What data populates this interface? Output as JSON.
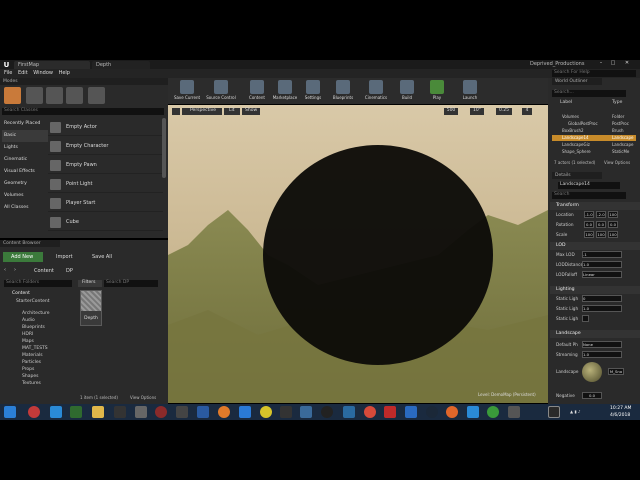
{
  "window": {
    "logo": "U",
    "tabs": [
      "FirstMap",
      "Depth"
    ],
    "project": "Deprived_Productions",
    "search_help_placeholder": "Search For Help"
  },
  "menu": [
    "File",
    "Edit",
    "Window",
    "Help"
  ],
  "modes": {
    "title": "Modes",
    "search_placeholder": "Search Classes",
    "categories": [
      "Recently Placed",
      "Basic",
      "Lights",
      "Cinematic",
      "Visual Effects",
      "Geometry",
      "Volumes",
      "All Classes"
    ],
    "items": [
      "Empty Actor",
      "Empty Character",
      "Empty Pawn",
      "Point Light",
      "Player Start",
      "Cube"
    ]
  },
  "toolbar": [
    "Save Current",
    "Source Control",
    "Content",
    "Marketplace",
    "Settings",
    "Blueprints",
    "Cinematics",
    "Build",
    "Play",
    "Launch"
  ],
  "viewport": {
    "perspective": "Perspective",
    "lit": "Lit",
    "show": "Show",
    "grid": "500",
    "angle": "10°",
    "scale": "0.25",
    "cam": "4",
    "level_label": "Level: DemoMap (Persistent)"
  },
  "content_browser": {
    "title": "Content Browser",
    "add_new": "Add New",
    "import": "Import",
    "save_all": "Save All",
    "path": [
      "Content",
      "DP"
    ],
    "search_folders_placeholder": "Search Folders",
    "filters": "Filters",
    "search_dp_placeholder": "Search DP",
    "tree": [
      "Content",
      "StarterContent",
      "Architecture",
      "Audio",
      "Blueprints",
      "HDRI",
      "Maps",
      "MAT_TESTS",
      "Materials",
      "Particles",
      "Props",
      "Shapes",
      "Textures"
    ],
    "asset_name": "Depth",
    "status": "1 item (1 selected)",
    "view_options": "View Options"
  },
  "outliner": {
    "title": "World Outliner",
    "search_placeholder": "Search...",
    "col_label": "Label",
    "col_type": "Type",
    "rows": [
      {
        "label": "Volumes",
        "type": "Folder"
      },
      {
        "label": "GlobalPostProc",
        "type": "PostProc"
      },
      {
        "label": "BoxBrush2",
        "type": "Brush"
      },
      {
        "label": "Landscape14",
        "type": "Landscape"
      },
      {
        "label": "LandscapeGiz",
        "type": "Landscape"
      },
      {
        "label": "Shape_Sphere",
        "type": "StaticMe"
      }
    ],
    "count": "7 actors (1 selected)",
    "view_options": "View Options"
  },
  "details": {
    "title": "Details",
    "name": "Landscape14",
    "search_placeholder": "Search",
    "transform": "Transform",
    "location": {
      "label": "Location",
      "values": [
        "-1.0",
        "-2.0",
        "100"
      ]
    },
    "rotation": {
      "label": "Rotation",
      "values": [
        "0.0",
        "0.0",
        "0.0"
      ]
    },
    "scale": {
      "label": "Scale",
      "values": [
        "100",
        "100",
        "100"
      ]
    },
    "lod": "LOD",
    "max_lod": {
      "label": "Max LOD",
      "value": "-1"
    },
    "lod_bias": {
      "label": "LODDistance",
      "value": "1.0"
    },
    "lod_falloff": {
      "label": "LODFalloff",
      "value": "Linear"
    },
    "lighting": "Lighting",
    "static_light_1": {
      "label": "Static Ligh",
      "value": "0"
    },
    "static_light_2": {
      "label": "Static Ligh",
      "value": "1.0"
    },
    "static_light_3": {
      "label": "Static Ligh"
    },
    "landscape": "Landscape",
    "default_phys": {
      "label": "Default Ph",
      "value": "None"
    },
    "streaming": {
      "label": "Streaming",
      "value": "1.0"
    },
    "landscape_mat": {
      "label": "Landscape",
      "value": "M_Sno"
    },
    "negative": {
      "label": "Negative",
      "value": "0.0"
    }
  },
  "taskbar": {
    "time": "10:27 AM",
    "date": "4/6/2018"
  }
}
